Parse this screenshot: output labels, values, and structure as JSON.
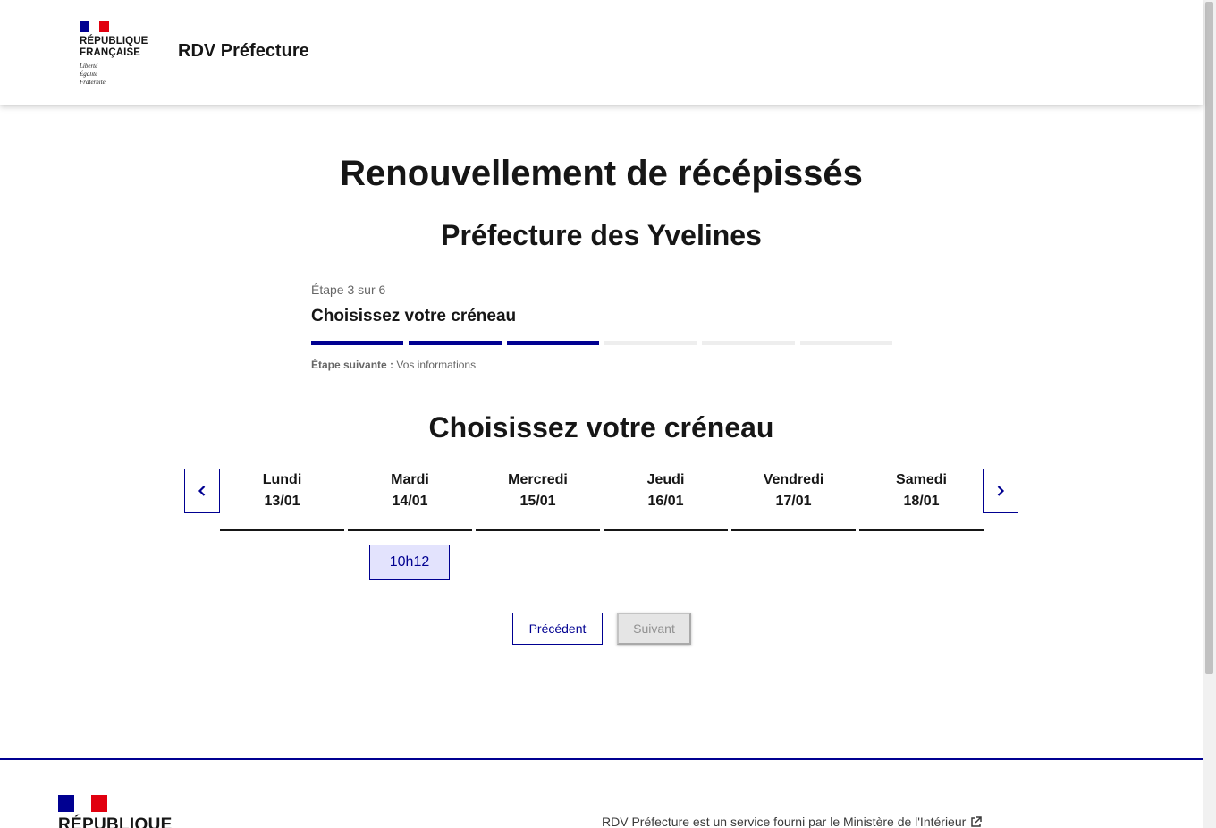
{
  "header": {
    "logo_lines": [
      "RÉPUBLIQUE",
      "FRANÇAISE"
    ],
    "motto": [
      "Liberté",
      "Égalité",
      "Fraternité"
    ],
    "service_title": "RDV Préfecture"
  },
  "main": {
    "title": "Renouvellement de récépissés",
    "subtitle": "Préfecture des Yvelines"
  },
  "stepper": {
    "state": "Étape 3 sur 6",
    "current_step": 3,
    "total_steps": 6,
    "title": "Choisissez votre créneau",
    "next_label": "Étape suivante :",
    "next_value": "Vos informations"
  },
  "slots_section": {
    "title": "Choisissez votre créneau",
    "days": [
      {
        "name": "Lundi",
        "date": "13/01"
      },
      {
        "name": "Mardi",
        "date": "14/01"
      },
      {
        "name": "Mercredi",
        "date": "15/01"
      },
      {
        "name": "Jeudi",
        "date": "16/01"
      },
      {
        "name": "Vendredi",
        "date": "17/01"
      },
      {
        "name": "Samedi",
        "date": "18/01"
      }
    ],
    "slot_time": "10h12",
    "slot_day": "Mardi 14/01"
  },
  "actions": {
    "previous": "Précédent",
    "next": "Suivant"
  },
  "footer": {
    "logo_text": "RÉPUBLIQUE",
    "description": "RDV Préfecture est un service fourni par le Ministère de l'Intérieur"
  },
  "colors": {
    "primary": "#000091",
    "flag_red": "#e1000f",
    "slot_bg": "#e3e3fd",
    "disabled_bg": "#e5e5e5",
    "step_inactive": "#eeeeee"
  },
  "icons": [
    "chevron-left-icon",
    "chevron-right-icon",
    "external-link-icon",
    "marianne-flag-icon"
  ]
}
